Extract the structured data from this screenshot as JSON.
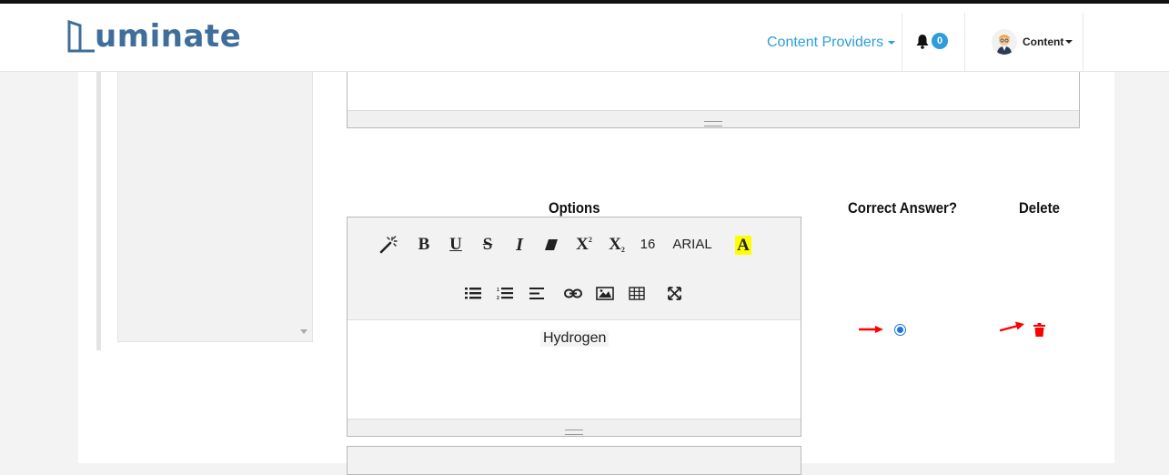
{
  "brand": {
    "name": "uminate",
    "color": "#3f6e9a"
  },
  "nav": {
    "providers_label": "Content Providers",
    "notifications_count": "0",
    "user_label": "Content",
    "accent": "#2d9ddb"
  },
  "columns": {
    "options": "Options",
    "correct_answer": "Correct Answer?",
    "delete": "Delete"
  },
  "toolbar": {
    "row1": [
      "magic-wand-icon",
      "bold-icon",
      "underline-icon",
      "strikethrough-icon",
      "italic-icon",
      "eraser-icon",
      "superscript-icon",
      "subscript-icon"
    ],
    "font_size": "16",
    "font_family": "ARIAL",
    "row2": [
      "unordered-list-icon",
      "ordered-list-icon",
      "align-icon",
      "link-icon",
      "image-icon",
      "table-icon",
      "fullscreen-icon"
    ],
    "highlight_color": "#ffff00"
  },
  "option": {
    "text": "Hydrogen",
    "is_correct": true
  },
  "colors": {
    "radio": "#1a73e8",
    "arrow": "#ff0000",
    "trash": "#ff0000"
  }
}
